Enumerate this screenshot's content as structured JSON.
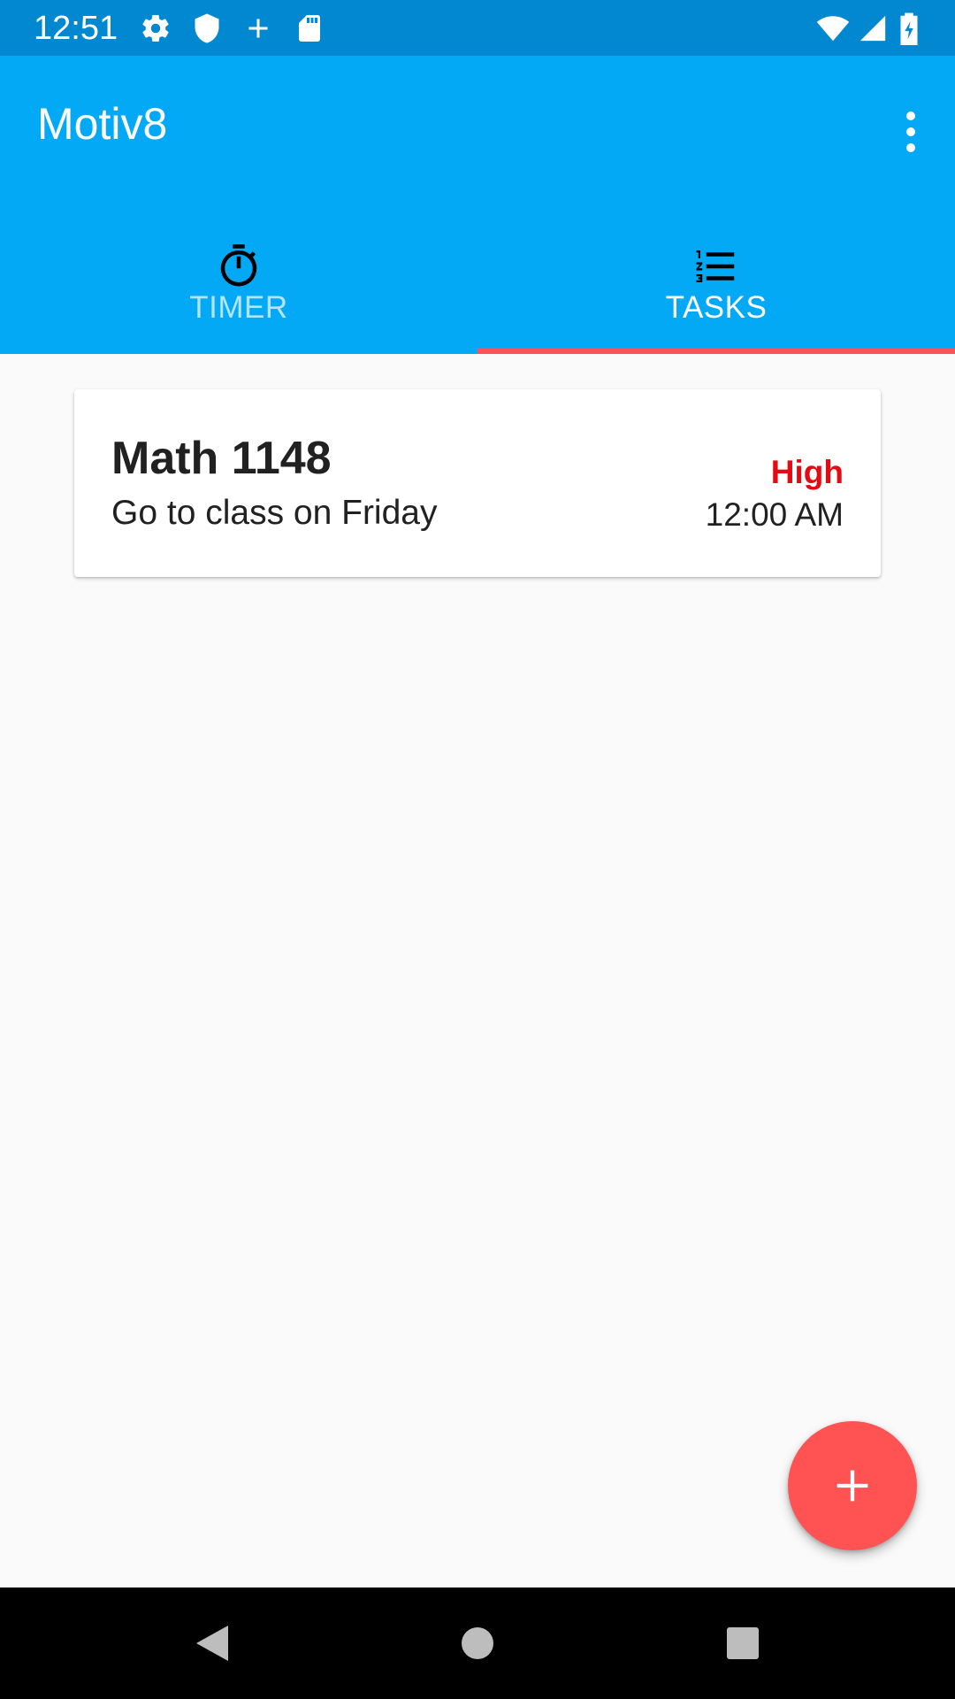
{
  "status_bar": {
    "time": "12:51",
    "left_icons": [
      "gear-icon",
      "shield-icon",
      "plus-icon",
      "sd-card-icon"
    ],
    "right_icons": [
      "wifi-icon",
      "cell-signal-icon",
      "battery-charging-icon"
    ]
  },
  "app_bar": {
    "title": "Motiv8",
    "background_color": "#03a9f4",
    "status_color": "#0288d1"
  },
  "tabs": [
    {
      "label": "TIMER",
      "icon": "stopwatch-icon",
      "selected": false
    },
    {
      "label": "TASKS",
      "icon": "numbered-list-icon",
      "selected": true
    }
  ],
  "tab_indicator_color": "#ff5252",
  "tasks": [
    {
      "title": "Math 1148",
      "description": "Go to class on Friday",
      "priority": "High",
      "priority_color": "#e50914",
      "time": "12:00 AM"
    }
  ],
  "fab": {
    "icon": "plus-icon",
    "color": "#ff5252"
  },
  "nav_bar": {
    "buttons": [
      "back-icon",
      "home-icon",
      "recents-icon"
    ]
  }
}
